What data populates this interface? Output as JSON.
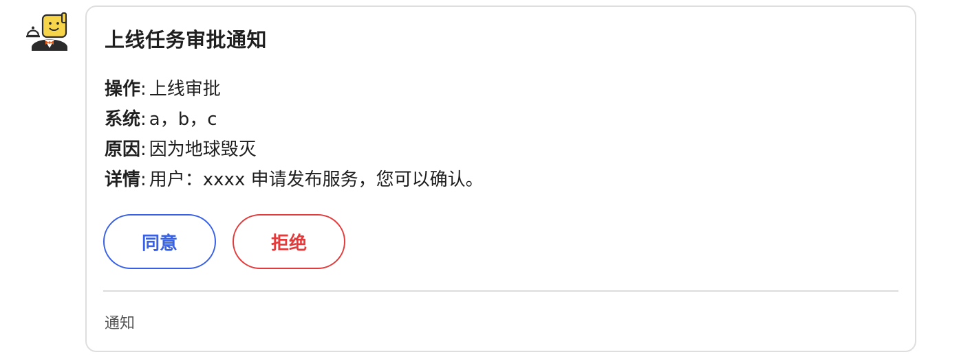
{
  "avatar": {
    "icon": "robot-butler-icon",
    "face_color": "#f6d54a"
  },
  "card": {
    "title": "上线任务审批通知",
    "fields": [
      {
        "key": "操作",
        "sep": ":",
        "value": "上线审批"
      },
      {
        "key": "系统",
        "sep": ":",
        "value": "a，b，c"
      },
      {
        "key": "原因",
        "sep": ":",
        "value": "因为地球毁灭"
      },
      {
        "key": "详情",
        "sep": ":",
        "value": "用户：xxxx 申请发布服务，您可以确认。"
      }
    ],
    "actions": {
      "agree_label": "同意",
      "agree_color": "#3760e6",
      "reject_label": "拒绝",
      "reject_color": "#e33b3b"
    },
    "footer": "通知"
  }
}
